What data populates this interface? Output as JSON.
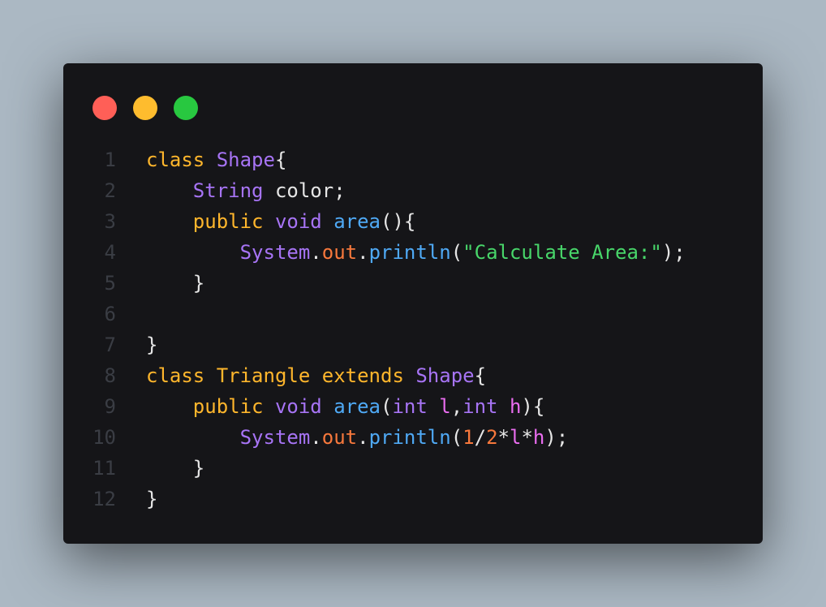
{
  "window": {
    "title_dots": [
      {
        "name": "close",
        "color": "#ff5f57"
      },
      {
        "name": "minimize",
        "color": "#febc2e"
      },
      {
        "name": "maximize",
        "color": "#28c840"
      }
    ]
  },
  "theme": {
    "keyword": "#ffb62c",
    "type": "#a774f5",
    "method": "#4fa9f5",
    "field": "#f7783c",
    "string": "#48d66a",
    "number": "#f7783c",
    "param": "#ea6df0",
    "plain": "#e6e6e6"
  },
  "code": {
    "lines": [
      {
        "num": "1",
        "tokens": [
          {
            "t": "class ",
            "c": "keyword"
          },
          {
            "t": "Shape",
            "c": "type"
          },
          {
            "t": "{",
            "c": "plain"
          }
        ]
      },
      {
        "num": "2",
        "tokens": [
          {
            "t": "    ",
            "c": "plain"
          },
          {
            "t": "String",
            "c": "type"
          },
          {
            "t": " color;",
            "c": "plain"
          }
        ]
      },
      {
        "num": "3",
        "tokens": [
          {
            "t": "    ",
            "c": "plain"
          },
          {
            "t": "public ",
            "c": "keyword"
          },
          {
            "t": "void ",
            "c": "type"
          },
          {
            "t": "area",
            "c": "method"
          },
          {
            "t": "(){",
            "c": "plain"
          }
        ]
      },
      {
        "num": "4",
        "tokens": [
          {
            "t": "        ",
            "c": "plain"
          },
          {
            "t": "System",
            "c": "type"
          },
          {
            "t": ".",
            "c": "plain"
          },
          {
            "t": "out",
            "c": "field"
          },
          {
            "t": ".",
            "c": "plain"
          },
          {
            "t": "println",
            "c": "method"
          },
          {
            "t": "(",
            "c": "plain"
          },
          {
            "t": "\"Calculate Area:\"",
            "c": "string"
          },
          {
            "t": ");",
            "c": "plain"
          }
        ]
      },
      {
        "num": "5",
        "tokens": [
          {
            "t": "    }",
            "c": "plain"
          }
        ]
      },
      {
        "num": "6",
        "tokens": []
      },
      {
        "num": "7",
        "tokens": [
          {
            "t": "}",
            "c": "plain"
          }
        ]
      },
      {
        "num": "8",
        "tokens": [
          {
            "t": "class ",
            "c": "keyword"
          },
          {
            "t": "Triangle ",
            "c": "keyword"
          },
          {
            "t": "extends ",
            "c": "keyword"
          },
          {
            "t": "Shape",
            "c": "type"
          },
          {
            "t": "{",
            "c": "plain"
          }
        ]
      },
      {
        "num": "9",
        "tokens": [
          {
            "t": "    ",
            "c": "plain"
          },
          {
            "t": "public ",
            "c": "keyword"
          },
          {
            "t": "void ",
            "c": "type"
          },
          {
            "t": "area",
            "c": "method"
          },
          {
            "t": "(",
            "c": "plain"
          },
          {
            "t": "int ",
            "c": "type"
          },
          {
            "t": "l",
            "c": "param"
          },
          {
            "t": ",",
            "c": "plain"
          },
          {
            "t": "int ",
            "c": "type"
          },
          {
            "t": "h",
            "c": "param"
          },
          {
            "t": "){",
            "c": "plain"
          }
        ]
      },
      {
        "num": "10",
        "tokens": [
          {
            "t": "        ",
            "c": "plain"
          },
          {
            "t": "System",
            "c": "type"
          },
          {
            "t": ".",
            "c": "plain"
          },
          {
            "t": "out",
            "c": "field"
          },
          {
            "t": ".",
            "c": "plain"
          },
          {
            "t": "println",
            "c": "method"
          },
          {
            "t": "(",
            "c": "plain"
          },
          {
            "t": "1",
            "c": "number"
          },
          {
            "t": "/",
            "c": "plain"
          },
          {
            "t": "2",
            "c": "number"
          },
          {
            "t": "*",
            "c": "plain"
          },
          {
            "t": "l",
            "c": "param"
          },
          {
            "t": "*",
            "c": "plain"
          },
          {
            "t": "h",
            "c": "param"
          },
          {
            "t": ");",
            "c": "plain"
          }
        ]
      },
      {
        "num": "11",
        "tokens": [
          {
            "t": "    }",
            "c": "plain"
          }
        ]
      },
      {
        "num": "12",
        "tokens": [
          {
            "t": "}",
            "c": "plain"
          }
        ]
      }
    ]
  }
}
